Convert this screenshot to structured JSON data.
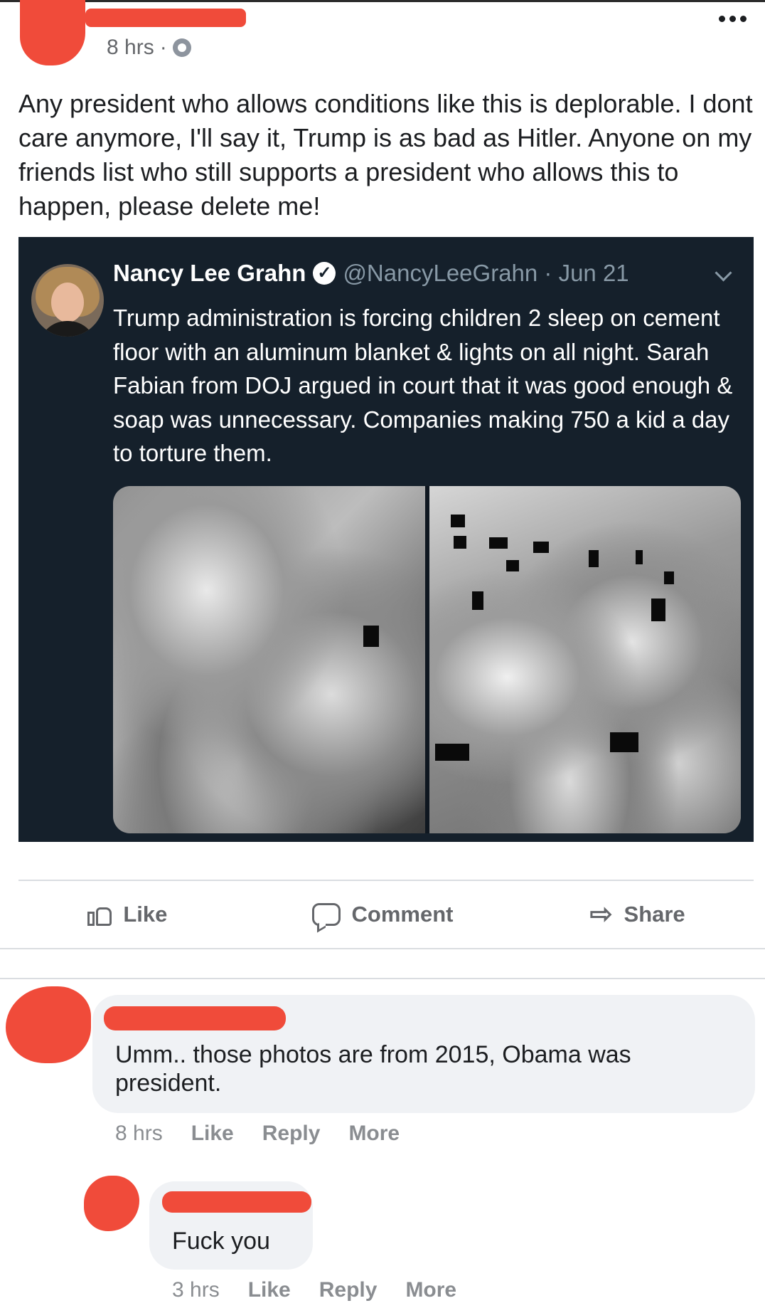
{
  "post": {
    "time": "8 hrs",
    "text": "Any president who allows conditions like this is deplorable. I dont care anymore, I'll say it, Trump is as bad as Hitler. Anyone on my friends list who still supports a president who allows this to happen, please delete me!"
  },
  "tweet": {
    "name": "Nancy Lee Grahn",
    "handle": "@NancyLeeGrahn · Jun 21",
    "text": "Trump administration is forcing children 2 sleep on cement floor with an aluminum blanket & lights on all night. Sarah Fabian from DOJ argued in court that it was good enough & soap was unnecessary. Companies making 750 a kid a day to torture them."
  },
  "actions": {
    "like": "Like",
    "comment": "Comment",
    "share": "Share"
  },
  "comments": [
    {
      "text": "Umm.. those photos are from 2015, Obama was president.",
      "time": "8 hrs",
      "like": "Like",
      "reply": "Reply",
      "more": "More"
    },
    {
      "text": "Fuck you",
      "time": "3 hrs",
      "like": "Like",
      "reply": "Reply",
      "more": "More"
    }
  ],
  "colors": {
    "tweet_background": "#15202b",
    "redaction": "#f04b3a",
    "comment_bubble": "#f0f2f5"
  }
}
